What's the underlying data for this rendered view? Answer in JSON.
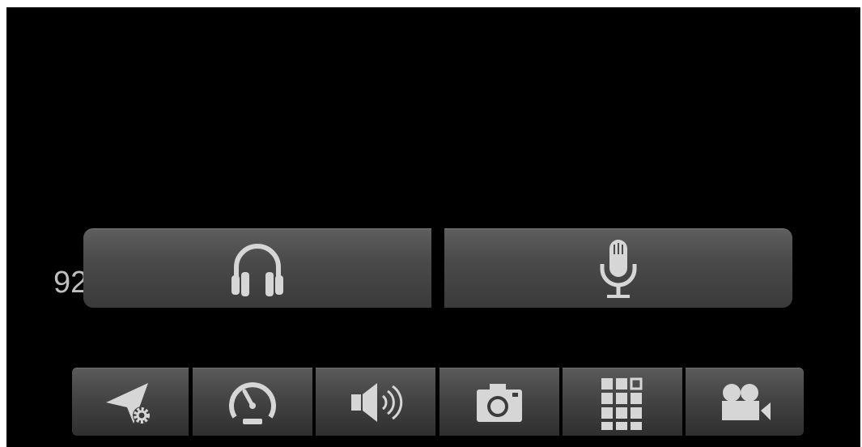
{
  "screen": {
    "partial_text": "92"
  },
  "popup": {
    "buttons": [
      {
        "icon": "headphones-icon"
      },
      {
        "icon": "microphone-icon"
      }
    ]
  },
  "toolbar": {
    "buttons": [
      {
        "icon": "navigation-settings-icon"
      },
      {
        "icon": "speedometer-icon"
      },
      {
        "icon": "speaker-volume-icon"
      },
      {
        "icon": "camera-icon"
      },
      {
        "icon": "grid-apps-icon"
      },
      {
        "icon": "video-camera-icon"
      }
    ]
  },
  "colors": {
    "background": "#000000",
    "button_top": "#5e5e5e",
    "button_bottom": "#3a3a3a",
    "icon": "#d6d6d6",
    "text": "#bfbfbf"
  }
}
